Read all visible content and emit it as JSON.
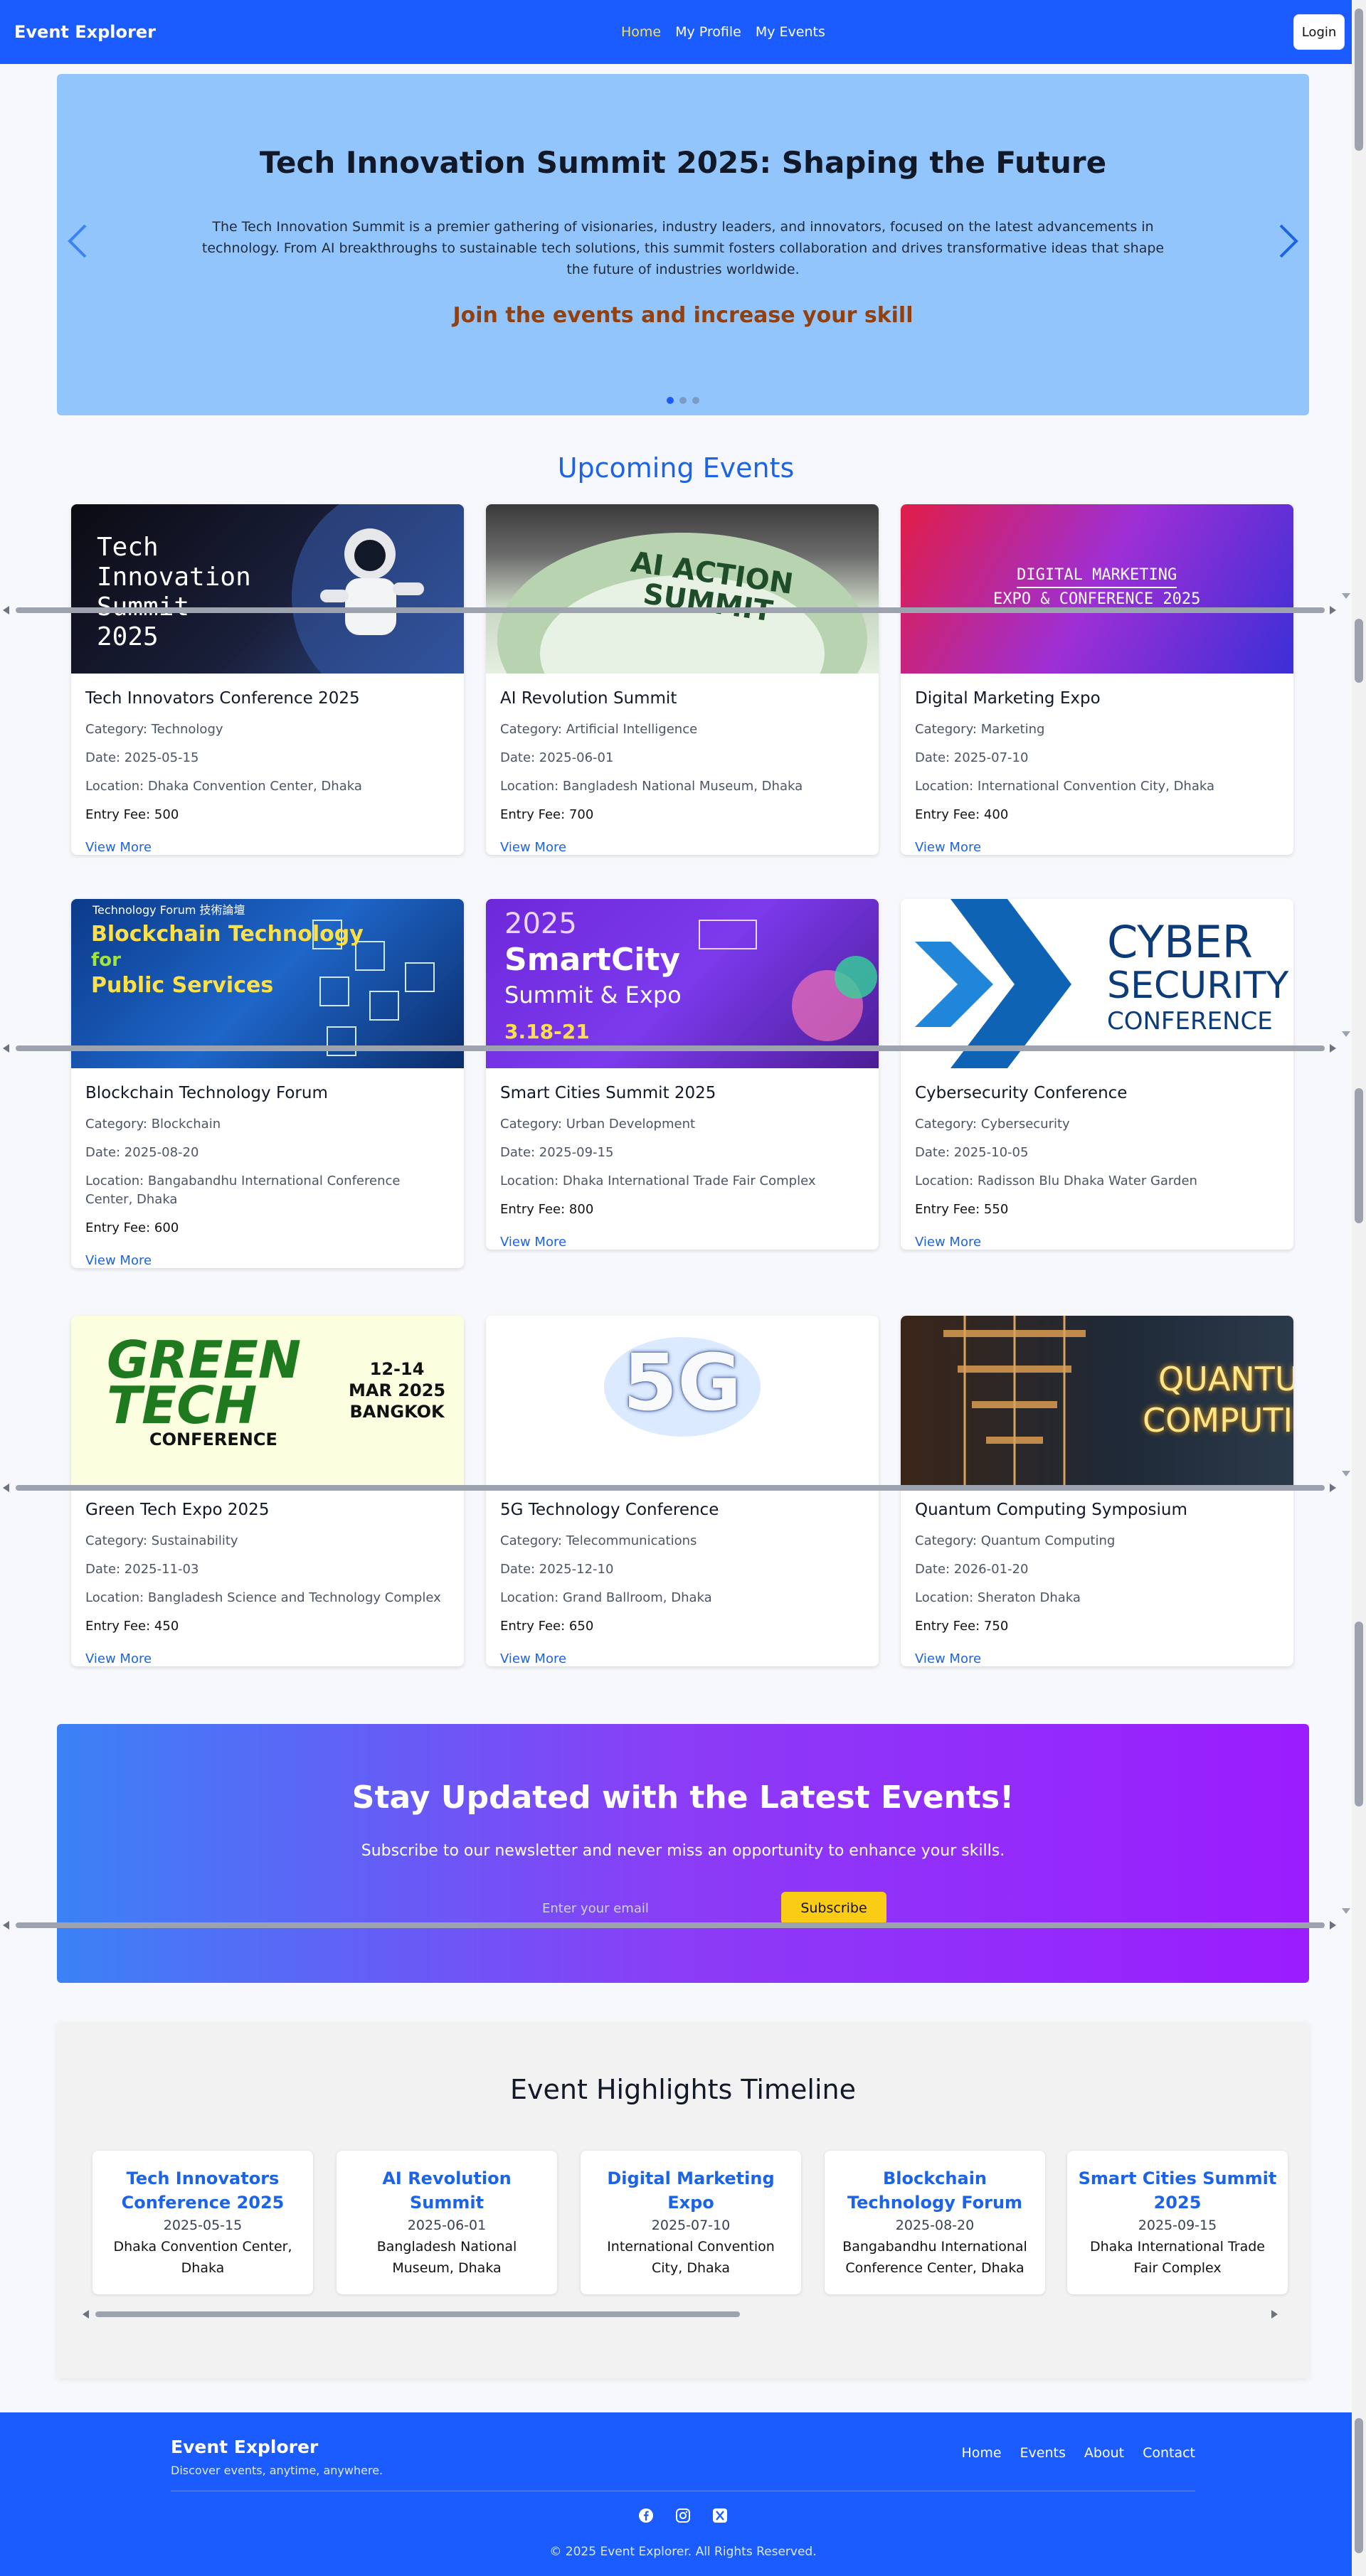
{
  "nav": {
    "brand": "Event Explorer",
    "links": [
      "Home",
      "My Profile",
      "My Events"
    ],
    "login": "Login"
  },
  "hero": {
    "title": "Tech Innovation Summit 2025: Shaping the Future",
    "description": "The Tech Innovation Summit is a premier gathering of visionaries, industry leaders, and innovators, focused on the latest advancements in technology. From AI breakthroughs to sustainable tech solutions, this summit fosters collaboration and drives transformative ideas that shape the future of industries worldwide.",
    "cta": "Join the events and increase your skill"
  },
  "upcoming": {
    "title": "Upcoming Events",
    "view_more": "View More",
    "events": [
      {
        "name": "Tech Innovators Conference 2025",
        "category": "Category: Technology",
        "date": "Date: 2025-05-15",
        "location": "Location: Dhaka Convention Center, Dhaka",
        "fee": "Entry Fee: 500",
        "img_text": [
          "Tech",
          "Innovation",
          "Summit",
          "2025"
        ]
      },
      {
        "name": "AI Revolution Summit",
        "category": "Category: Artificial Intelligence",
        "date": "Date: 2025-06-01",
        "location": "Location: Bangladesh National Museum, Dhaka",
        "fee": "Entry Fee: 700",
        "img_text": [
          "AI ACTION",
          "SUMMIT"
        ]
      },
      {
        "name": "Digital Marketing Expo",
        "category": "Category: Marketing",
        "date": "Date: 2025-07-10",
        "location": "Location: International Convention City, Dhaka",
        "fee": "Entry Fee: 400",
        "img_text": [
          "DIGITAL MARKETING",
          "EXPO & CONFERENCE 2025"
        ]
      },
      {
        "name": "Blockchain Technology Forum",
        "category": "Category: Blockchain",
        "date": "Date: 2025-08-20",
        "location": "Location: Bangabandhu International Conference Center, Dhaka",
        "fee": "Entry Fee: 600",
        "img_text": [
          "Technology Forum 技術論壇",
          "Blockchain Technology",
          "for",
          "Public Services"
        ]
      },
      {
        "name": "Smart Cities Summit 2025",
        "category": "Category: Urban Development",
        "date": "Date: 2025-09-15",
        "location": "Location: Dhaka International Trade Fair Complex",
        "fee": "Entry Fee: 800",
        "img_text": [
          "2025",
          "SmartCity",
          "Summit & Expo",
          "3.18-21"
        ]
      },
      {
        "name": "Cybersecurity Conference",
        "category": "Category: Cybersecurity",
        "date": "Date: 2025-10-05",
        "location": "Location: Radisson Blu Dhaka Water Garden",
        "fee": "Entry Fee: 550",
        "img_text": [
          "CYBER",
          "SECURITY",
          "CONFERENCE"
        ]
      },
      {
        "name": "Green Tech Expo 2025",
        "category": "Category: Sustainability",
        "date": "Date: 2025-11-03",
        "location": "Location: Bangladesh Science and Technology Complex",
        "fee": "Entry Fee: 450",
        "img_text": [
          "GREEN",
          "TECH",
          "CONFERENCE",
          "12-14",
          "MAR 2025",
          "BANGKOK"
        ]
      },
      {
        "name": "5G Technology Conference",
        "category": "Category: Telecommunications",
        "date": "Date: 2025-12-10",
        "location": "Location: Grand Ballroom, Dhaka",
        "fee": "Entry Fee: 650",
        "img_text": [
          "5G"
        ]
      },
      {
        "name": "Quantum Computing Symposium",
        "category": "Category: Quantum Computing",
        "date": "Date: 2026-01-20",
        "location": "Location: Sheraton Dhaka",
        "fee": "Entry Fee: 750",
        "img_text": [
          "QUANTUM",
          "COMPUTING"
        ]
      }
    ]
  },
  "newsletter": {
    "title": "Stay Updated with the Latest Events!",
    "subtitle": "Subscribe to our newsletter and never miss an opportunity to enhance your skills.",
    "placeholder": "Enter your email",
    "button": "Subscribe"
  },
  "timeline": {
    "title": "Event Highlights Timeline",
    "items": [
      {
        "name": "Tech Innovators Conference 2025",
        "date": "2025-05-15",
        "location": "Dhaka Convention Center, Dhaka"
      },
      {
        "name": "AI Revolution Summit",
        "date": "2025-06-01",
        "location": "Bangladesh National Museum, Dhaka"
      },
      {
        "name": "Digital Marketing Expo",
        "date": "2025-07-10",
        "location": "International Convention City, Dhaka"
      },
      {
        "name": "Blockchain Technology Forum",
        "date": "2025-08-20",
        "location": "Bangabandhu International Conference Center, Dhaka"
      },
      {
        "name": "Smart Cities Summit 2025",
        "date": "2025-09-15",
        "location": "Dhaka International Trade Fair Complex"
      }
    ]
  },
  "footer": {
    "brand": "Event Explorer",
    "tagline": "Discover events, anytime, anywhere.",
    "links": [
      "Home",
      "Events",
      "About",
      "Contact"
    ],
    "social": [
      "facebook-icon",
      "instagram-icon",
      "x-icon"
    ],
    "copyright": "© 2025 Event Explorer. All Rights Reserved."
  },
  "colors": {
    "primary": "#1a5cff",
    "accent_yellow": "#fde047",
    "link_blue": "#1d63e6",
    "hero_bg": "#93c5fd",
    "cta_brown": "#92400e"
  }
}
